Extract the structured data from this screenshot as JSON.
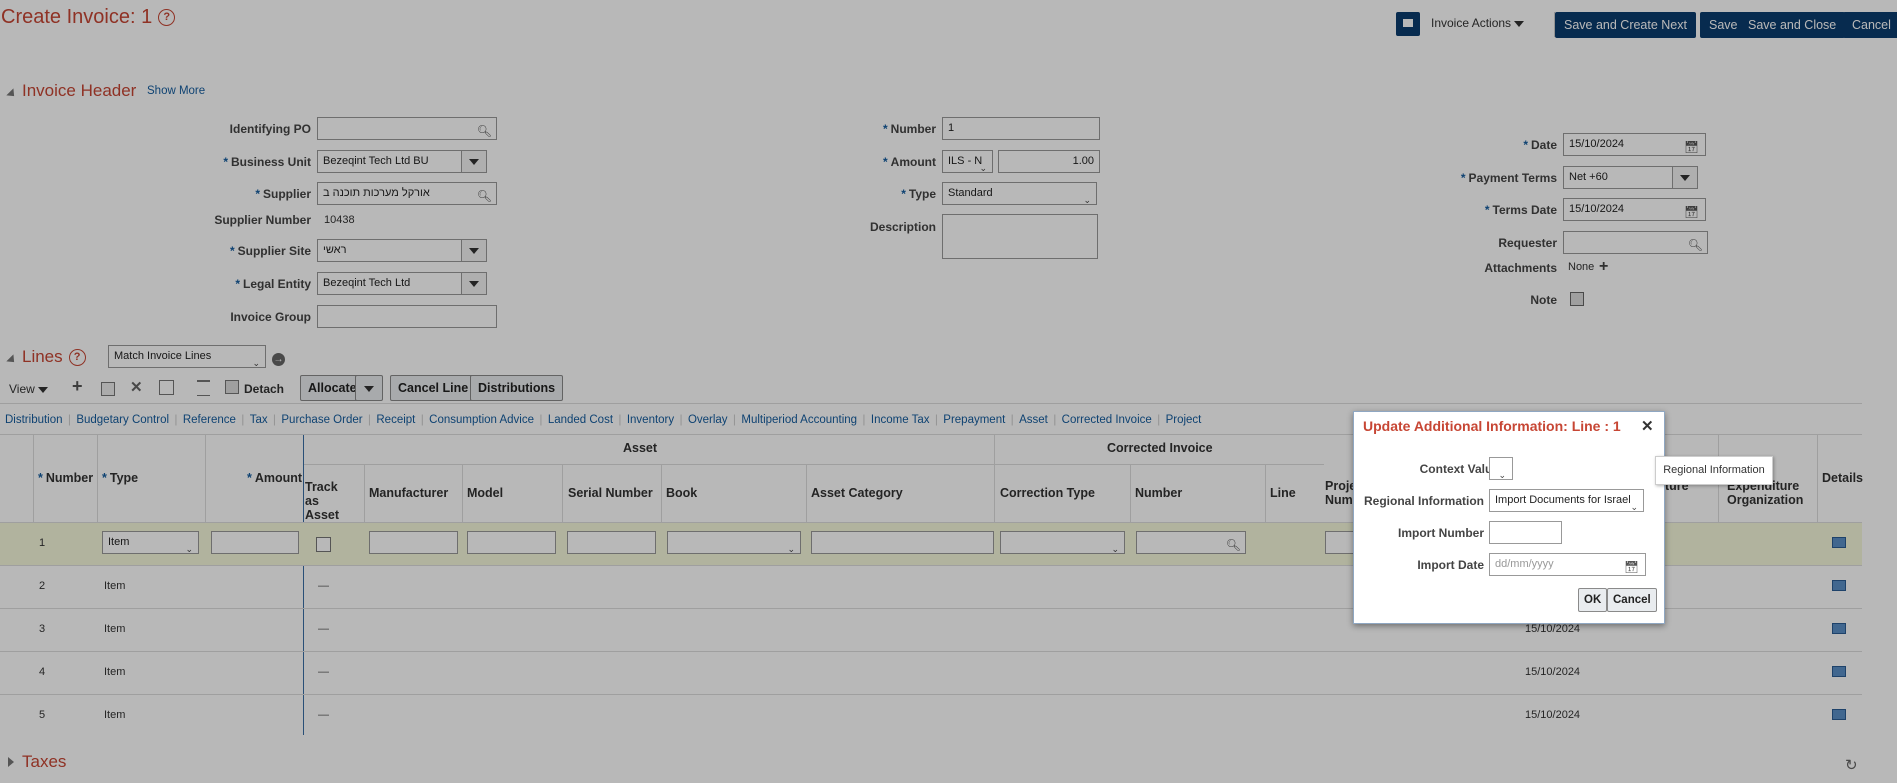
{
  "page": {
    "title": "Create Invoice: 1",
    "help_glyph": "?",
    "invoice_actions": "Invoice Actions",
    "save_create_next": "Save and Create Next",
    "save": "Save",
    "save_close": "Save and Close",
    "cancel": "Cancel"
  },
  "header": {
    "title": "Invoice Header",
    "show_more": "Show More",
    "identifying_po": {
      "label": "Identifying PO",
      "value": ""
    },
    "business_unit": {
      "label": "Business Unit",
      "value": "Bezeqint Tech Ltd BU"
    },
    "supplier": {
      "label": "Supplier",
      "value": "אורקל מערכות תוכנה ב"
    },
    "supplier_number": {
      "label": "Supplier Number",
      "value": "10438"
    },
    "supplier_site": {
      "label": "Supplier Site",
      "value": "ראשי"
    },
    "legal_entity": {
      "label": "Legal Entity",
      "value": "Bezeqint Tech Ltd"
    },
    "invoice_group": {
      "label": "Invoice Group",
      "value": ""
    },
    "number": {
      "label": "Number",
      "value": "1"
    },
    "amount": {
      "label": "Amount",
      "currency": "ILS - N",
      "value": "1.00"
    },
    "type": {
      "label": "Type",
      "value": "Standard"
    },
    "description": {
      "label": "Description",
      "value": ""
    },
    "date": {
      "label": "Date",
      "value": "15/10/2024"
    },
    "payment_terms": {
      "label": "Payment Terms",
      "value": "Net +60"
    },
    "terms_date": {
      "label": "Terms Date",
      "value": "15/10/2024"
    },
    "requester": {
      "label": "Requester",
      "value": ""
    },
    "attachments": {
      "label": "Attachments",
      "value": "None"
    },
    "note": {
      "label": "Note"
    }
  },
  "lines": {
    "title": "Lines",
    "match_select": "Match Invoice Lines",
    "view": "View",
    "detach": "Detach",
    "allocate": "Allocate",
    "cancel_line": "Cancel Line",
    "distributions": "Distributions",
    "tabs": [
      "Distribution",
      "Budgetary Control",
      "Reference",
      "Tax",
      "Purchase Order",
      "Receipt",
      "Consumption Advice",
      "Landed Cost",
      "Inventory",
      "Overlay",
      "Multiperiod Accounting",
      "Income Tax",
      "Prepayment",
      "Asset",
      "Corrected Invoice",
      "Project"
    ],
    "group_headers": {
      "asset": "Asset",
      "corrected_invoice": "Corrected Invoice"
    },
    "columns": {
      "number": "Number",
      "type": "Type",
      "amount": "Amount",
      "track_as_asset": "Track as Asset",
      "manufacturer": "Manufacturer",
      "model": "Model",
      "serial_number": "Serial Number",
      "book": "Book",
      "asset_category": "Asset Category",
      "correction_type": "Correction Type",
      "ci_number": "Number",
      "line": "Line",
      "project_number": "Proje Numb",
      "expenditure_item_date": "ture",
      "expenditure_organization": "Expenditure Organization",
      "details": "Details"
    },
    "rows": [
      {
        "number": "1",
        "type": "Item",
        "date": ""
      },
      {
        "number": "2",
        "type": "Item",
        "dash": "—",
        "date": ""
      },
      {
        "number": "3",
        "type": "Item",
        "dash": "—",
        "date": "15/10/2024"
      },
      {
        "number": "4",
        "type": "Item",
        "dash": "—",
        "date": "15/10/2024"
      },
      {
        "number": "5",
        "type": "Item",
        "dash": "—",
        "date": "15/10/2024"
      }
    ]
  },
  "taxes": {
    "title": "Taxes"
  },
  "dialog": {
    "title": "Update Additional Information: Line : 1",
    "context_value": {
      "label": "Context Value",
      "value": ""
    },
    "regional_information": {
      "label": "Regional Information",
      "value": "Import Documents for Israel"
    },
    "import_number": {
      "label": "Import Number",
      "value": ""
    },
    "import_date": {
      "label": "Import Date",
      "placeholder": "dd/mm/yyyy"
    },
    "ok": "OK",
    "cancel": "Cancel"
  },
  "tooltip": {
    "text": "Regional Information"
  }
}
